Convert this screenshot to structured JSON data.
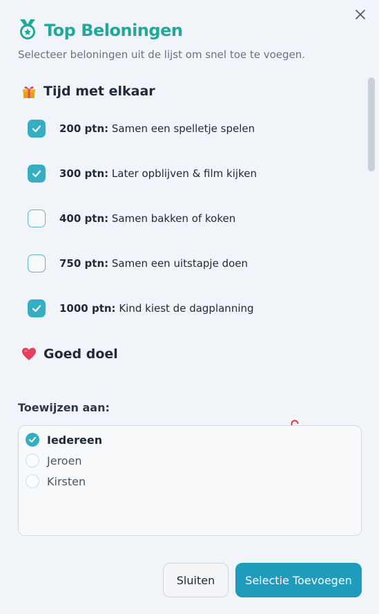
{
  "dialog": {
    "title": "Top Beloningen",
    "subtitle": "Selecteer beloningen uit de lijst om snel toe te voegen."
  },
  "categories": [
    {
      "icon": "gift-icon",
      "label": "Tijd met elkaar",
      "rewards": [
        {
          "points": "200 ptn:",
          "text": " Samen een spelletje spelen",
          "checked": true
        },
        {
          "points": "300 ptn:",
          "text": " Later opblijven & film kijken",
          "checked": true
        },
        {
          "points": "400 ptn:",
          "text": " Samen bakken of koken",
          "checked": false
        },
        {
          "points": "750 ptn:",
          "text": " Samen een uitstapje doen",
          "checked": false
        },
        {
          "points": "1000 ptn:",
          "text": " Kind kiest de dagplanning",
          "checked": true
        }
      ]
    },
    {
      "icon": "heart-icon",
      "label": "Goed doel",
      "rewards": []
    }
  ],
  "assign": {
    "label": "Toewijzen aan:",
    "people": [
      {
        "name": "Iedereen",
        "selected": true
      },
      {
        "name": "Jeroen",
        "selected": false
      },
      {
        "name": "Kirsten",
        "selected": false
      }
    ]
  },
  "buttons": {
    "close": "Sluiten",
    "add": "Selectie Toevoegen"
  },
  "colors": {
    "accent": "#35aec4",
    "title": "#22a79b",
    "primary_button": "#1f9bbb",
    "lock": "#e0262e"
  }
}
